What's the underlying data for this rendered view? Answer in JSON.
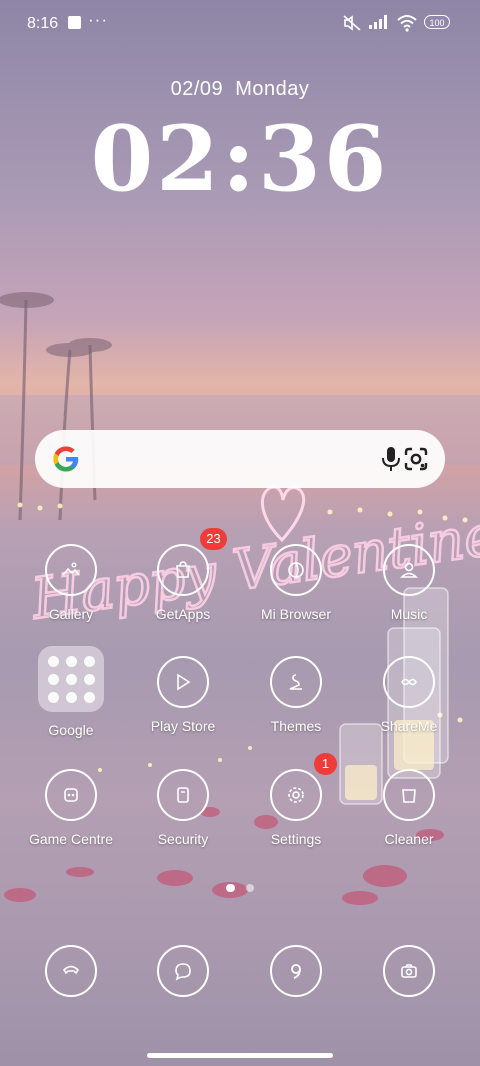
{
  "status_bar": {
    "time": "8:16",
    "more": "···",
    "battery": "100"
  },
  "lockclock": {
    "date": "02/09",
    "day": "Monday",
    "time": "02:36"
  },
  "wallpaper_text": "Happy Valentine's Day",
  "search": {
    "logo": "G"
  },
  "apps": [
    {
      "label": "Gallery",
      "icon": "gallery-icon"
    },
    {
      "label": "GetApps",
      "icon": "getapps-icon",
      "badge": "23"
    },
    {
      "label": "Mi Browser",
      "icon": "browser-icon"
    },
    {
      "label": "Music",
      "icon": "music-icon"
    },
    {
      "label": "Google",
      "icon": "google-folder-icon"
    },
    {
      "label": "Play Store",
      "icon": "play-store-icon"
    },
    {
      "label": "Themes",
      "icon": "themes-icon"
    },
    {
      "label": "ShareMe",
      "icon": "shareme-icon"
    },
    {
      "label": "Game Centre",
      "icon": "game-centre-icon"
    },
    {
      "label": "Security",
      "icon": "security-icon"
    },
    {
      "label": "Settings",
      "icon": "settings-icon",
      "badge": "1"
    },
    {
      "label": "Cleaner",
      "icon": "cleaner-icon"
    }
  ],
  "dock": [
    {
      "icon": "phone-icon"
    },
    {
      "icon": "messages-icon"
    },
    {
      "icon": "browser-icon"
    },
    {
      "icon": "camera-icon"
    }
  ],
  "colors": {
    "badge": "#f03b3b",
    "search_bg": "#ffffff"
  }
}
